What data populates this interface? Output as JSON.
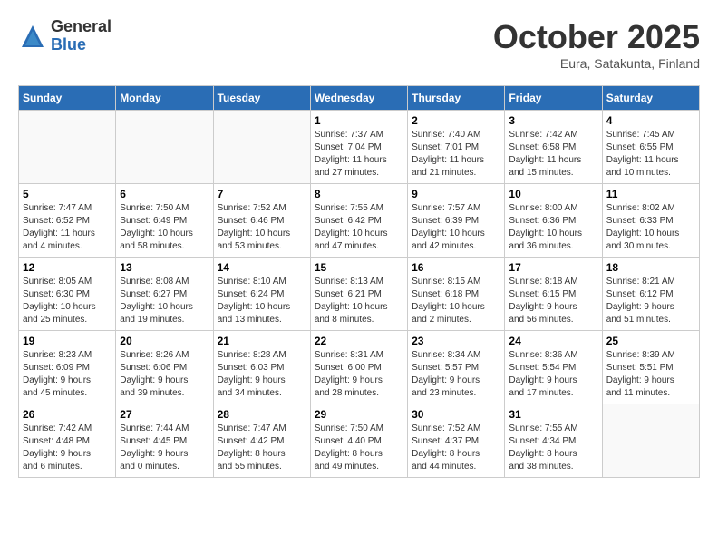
{
  "header": {
    "logo_general": "General",
    "logo_blue": "Blue",
    "month_title": "October 2025",
    "location": "Eura, Satakunta, Finland"
  },
  "days_of_week": [
    "Sunday",
    "Monday",
    "Tuesday",
    "Wednesday",
    "Thursday",
    "Friday",
    "Saturday"
  ],
  "weeks": [
    [
      {
        "day": "",
        "info": ""
      },
      {
        "day": "",
        "info": ""
      },
      {
        "day": "",
        "info": ""
      },
      {
        "day": "1",
        "info": "Sunrise: 7:37 AM\nSunset: 7:04 PM\nDaylight: 11 hours\nand 27 minutes."
      },
      {
        "day": "2",
        "info": "Sunrise: 7:40 AM\nSunset: 7:01 PM\nDaylight: 11 hours\nand 21 minutes."
      },
      {
        "day": "3",
        "info": "Sunrise: 7:42 AM\nSunset: 6:58 PM\nDaylight: 11 hours\nand 15 minutes."
      },
      {
        "day": "4",
        "info": "Sunrise: 7:45 AM\nSunset: 6:55 PM\nDaylight: 11 hours\nand 10 minutes."
      }
    ],
    [
      {
        "day": "5",
        "info": "Sunrise: 7:47 AM\nSunset: 6:52 PM\nDaylight: 11 hours\nand 4 minutes."
      },
      {
        "day": "6",
        "info": "Sunrise: 7:50 AM\nSunset: 6:49 PM\nDaylight: 10 hours\nand 58 minutes."
      },
      {
        "day": "7",
        "info": "Sunrise: 7:52 AM\nSunset: 6:46 PM\nDaylight: 10 hours\nand 53 minutes."
      },
      {
        "day": "8",
        "info": "Sunrise: 7:55 AM\nSunset: 6:42 PM\nDaylight: 10 hours\nand 47 minutes."
      },
      {
        "day": "9",
        "info": "Sunrise: 7:57 AM\nSunset: 6:39 PM\nDaylight: 10 hours\nand 42 minutes."
      },
      {
        "day": "10",
        "info": "Sunrise: 8:00 AM\nSunset: 6:36 PM\nDaylight: 10 hours\nand 36 minutes."
      },
      {
        "day": "11",
        "info": "Sunrise: 8:02 AM\nSunset: 6:33 PM\nDaylight: 10 hours\nand 30 minutes."
      }
    ],
    [
      {
        "day": "12",
        "info": "Sunrise: 8:05 AM\nSunset: 6:30 PM\nDaylight: 10 hours\nand 25 minutes."
      },
      {
        "day": "13",
        "info": "Sunrise: 8:08 AM\nSunset: 6:27 PM\nDaylight: 10 hours\nand 19 minutes."
      },
      {
        "day": "14",
        "info": "Sunrise: 8:10 AM\nSunset: 6:24 PM\nDaylight: 10 hours\nand 13 minutes."
      },
      {
        "day": "15",
        "info": "Sunrise: 8:13 AM\nSunset: 6:21 PM\nDaylight: 10 hours\nand 8 minutes."
      },
      {
        "day": "16",
        "info": "Sunrise: 8:15 AM\nSunset: 6:18 PM\nDaylight: 10 hours\nand 2 minutes."
      },
      {
        "day": "17",
        "info": "Sunrise: 8:18 AM\nSunset: 6:15 PM\nDaylight: 9 hours\nand 56 minutes."
      },
      {
        "day": "18",
        "info": "Sunrise: 8:21 AM\nSunset: 6:12 PM\nDaylight: 9 hours\nand 51 minutes."
      }
    ],
    [
      {
        "day": "19",
        "info": "Sunrise: 8:23 AM\nSunset: 6:09 PM\nDaylight: 9 hours\nand 45 minutes."
      },
      {
        "day": "20",
        "info": "Sunrise: 8:26 AM\nSunset: 6:06 PM\nDaylight: 9 hours\nand 39 minutes."
      },
      {
        "day": "21",
        "info": "Sunrise: 8:28 AM\nSunset: 6:03 PM\nDaylight: 9 hours\nand 34 minutes."
      },
      {
        "day": "22",
        "info": "Sunrise: 8:31 AM\nSunset: 6:00 PM\nDaylight: 9 hours\nand 28 minutes."
      },
      {
        "day": "23",
        "info": "Sunrise: 8:34 AM\nSunset: 5:57 PM\nDaylight: 9 hours\nand 23 minutes."
      },
      {
        "day": "24",
        "info": "Sunrise: 8:36 AM\nSunset: 5:54 PM\nDaylight: 9 hours\nand 17 minutes."
      },
      {
        "day": "25",
        "info": "Sunrise: 8:39 AM\nSunset: 5:51 PM\nDaylight: 9 hours\nand 11 minutes."
      }
    ],
    [
      {
        "day": "26",
        "info": "Sunrise: 7:42 AM\nSunset: 4:48 PM\nDaylight: 9 hours\nand 6 minutes."
      },
      {
        "day": "27",
        "info": "Sunrise: 7:44 AM\nSunset: 4:45 PM\nDaylight: 9 hours\nand 0 minutes."
      },
      {
        "day": "28",
        "info": "Sunrise: 7:47 AM\nSunset: 4:42 PM\nDaylight: 8 hours\nand 55 minutes."
      },
      {
        "day": "29",
        "info": "Sunrise: 7:50 AM\nSunset: 4:40 PM\nDaylight: 8 hours\nand 49 minutes."
      },
      {
        "day": "30",
        "info": "Sunrise: 7:52 AM\nSunset: 4:37 PM\nDaylight: 8 hours\nand 44 minutes."
      },
      {
        "day": "31",
        "info": "Sunrise: 7:55 AM\nSunset: 4:34 PM\nDaylight: 8 hours\nand 38 minutes."
      },
      {
        "day": "",
        "info": ""
      }
    ]
  ]
}
